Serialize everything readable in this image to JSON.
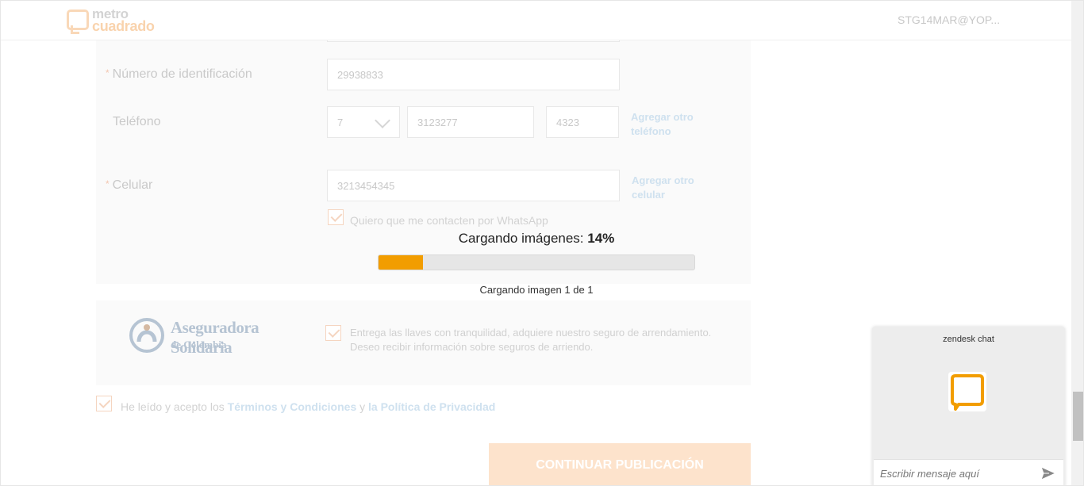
{
  "header": {
    "logo_line1": "metro",
    "logo_line2": "cuadrado",
    "user": "STG14MAR@YOP..."
  },
  "form": {
    "id_label": "Número de identificación",
    "id_value": "29938833",
    "phone_label": "Teléfono",
    "phone_indicative": "7",
    "phone_number": "3123277",
    "phone_ext": "4323",
    "phone_add_link": "Agregar otro teléfono",
    "cell_label": "Celular",
    "cell_value": "3213454345",
    "cell_add_link": "Agregar otro celular",
    "whatsapp_label": "Quiero que me contacten por WhatsApp"
  },
  "progress": {
    "title": "Cargando imágenes:",
    "percent_label": "14%",
    "percent": 14,
    "subtitle": "Cargando imagen 1 de 1",
    "fill_color": "#f29d00"
  },
  "insurance": {
    "logo_line1": "Aseguradora Solidaria",
    "logo_line2": "de Colombia",
    "text": "Entrega las llaves con tranquilidad, adquiere nuestro seguro de arrendamiento. Deseo recibir información sobre seguros de arriendo."
  },
  "terms": {
    "prefix": "He leído y acepto los",
    "terms_link": "Términos y Condiciones",
    "connector": "y",
    "privacy_link": "la Política de Privacidad"
  },
  "continue_button": "CONTINUAR PUBLICACIÓN",
  "chat": {
    "title": "zendesk chat",
    "input_placeholder": "Escribir mensaje aquí",
    "accent": "#f29d00"
  }
}
